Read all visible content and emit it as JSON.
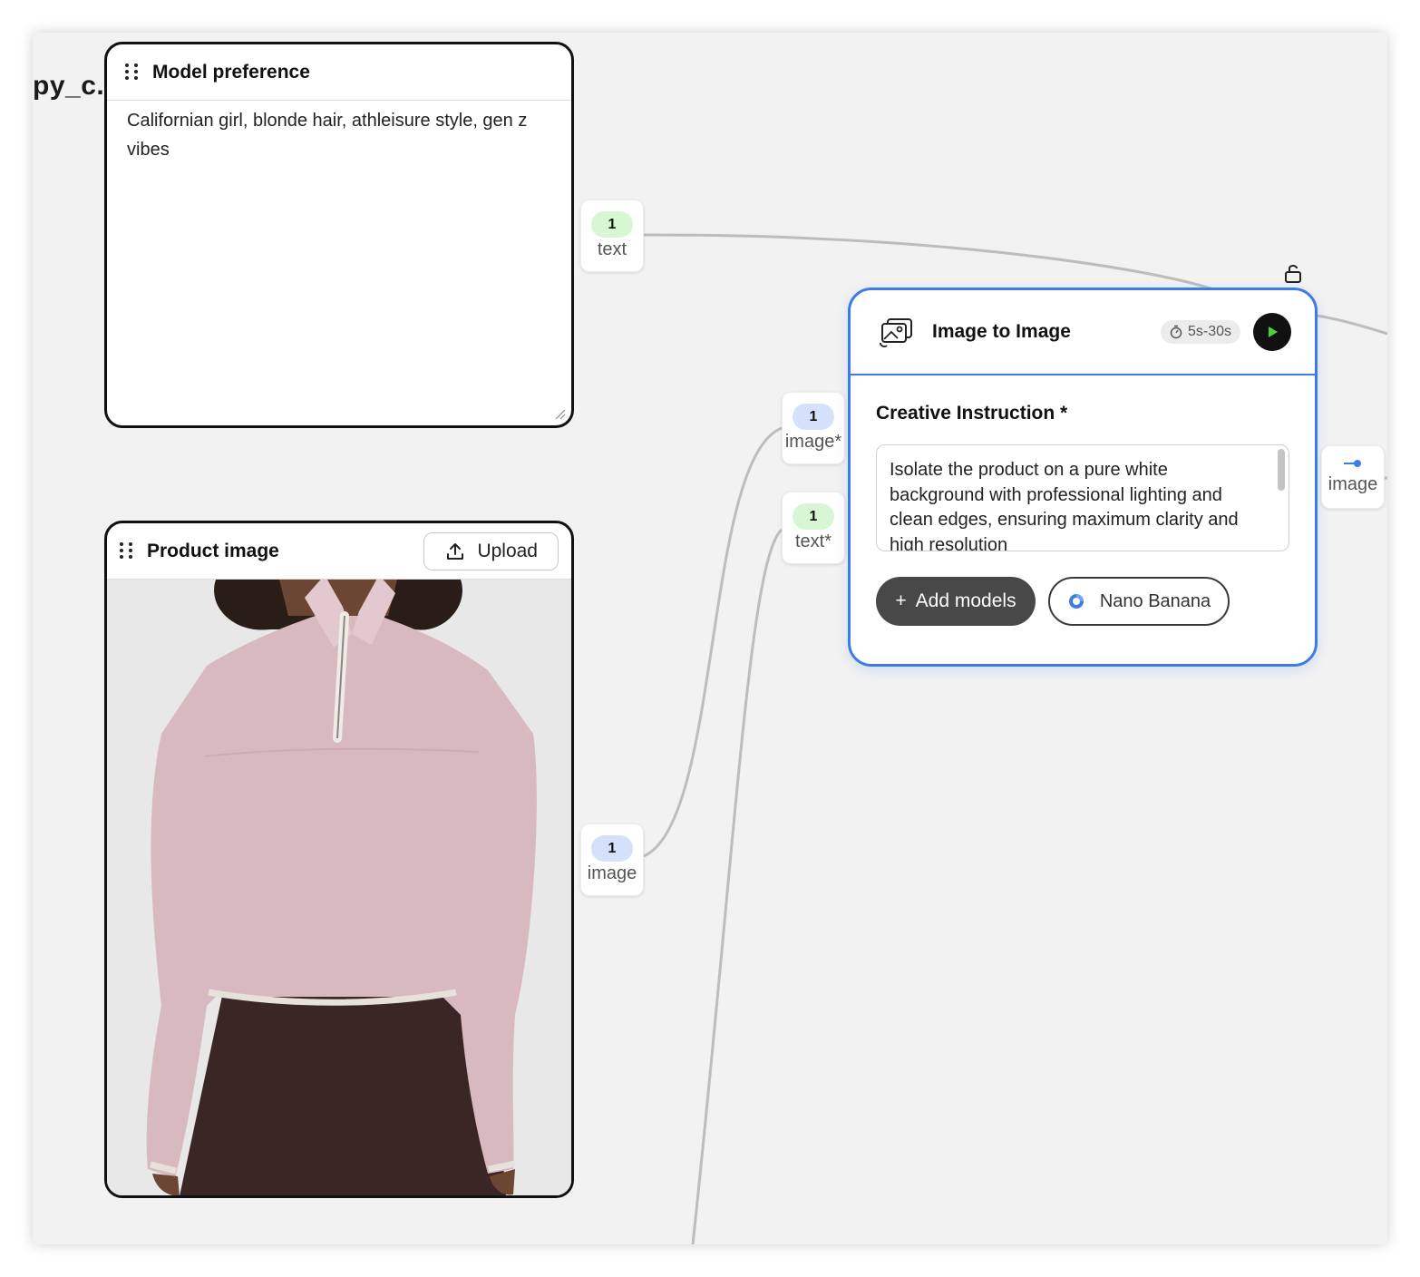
{
  "canvas": {
    "clipped_title": "py_c..."
  },
  "model_preference": {
    "title": "Model preference",
    "text": "Californian girl, blonde hair, athleisure style, gen z vibes",
    "output_port": {
      "count": "1",
      "label": "text"
    }
  },
  "product_image": {
    "title": "Product image",
    "upload_label": "Upload",
    "image_icon": "fleece-sweater-photo",
    "output_port": {
      "count": "1",
      "label": "image"
    }
  },
  "image_to_image": {
    "title": "Image to Image",
    "duration": "5s-30s",
    "creative_instruction_label": "Creative Instruction *",
    "creative_instruction": "Isolate the product on a pure white background with professional lighting and clean edges, ensuring maximum clarity and high resolution",
    "add_models_label": "Add models",
    "model_chip": "Nano Banana",
    "input_ports": [
      {
        "count": "1",
        "label": "image*"
      },
      {
        "count": "1",
        "label": "text*"
      }
    ],
    "output_port": {
      "label": "image"
    }
  },
  "colors": {
    "accent": "#3b7ce6",
    "run_play": "#4cd137",
    "text_pill": "#d7f7d3",
    "image_pill": "#d5e1fb"
  }
}
